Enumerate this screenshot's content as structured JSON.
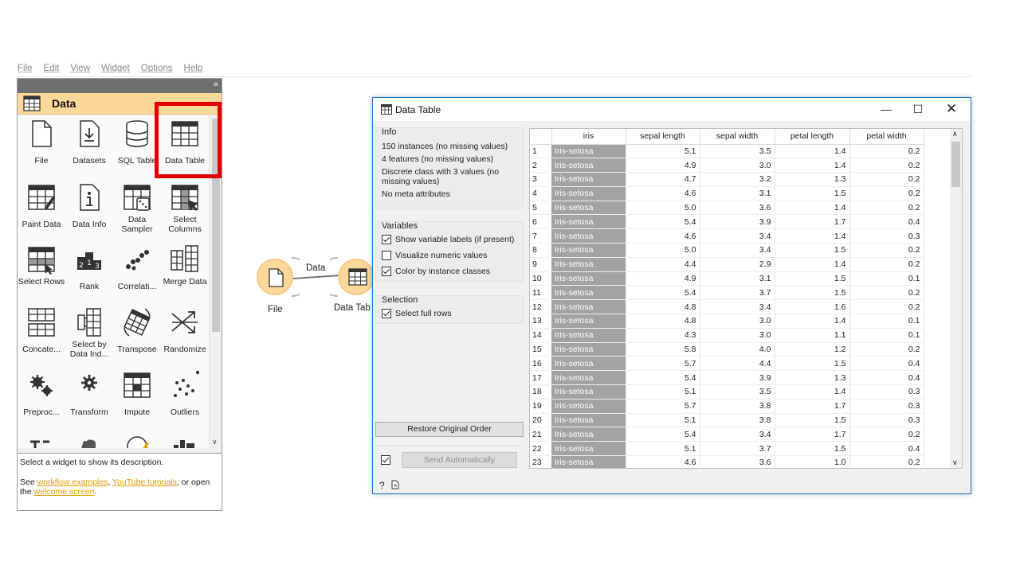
{
  "menu": [
    "File",
    "Edit",
    "View",
    "Widget",
    "Options",
    "Help"
  ],
  "panel": {
    "collapse": "«",
    "category": "Data",
    "widgets": [
      {
        "label": "File",
        "icon": "file-icon"
      },
      {
        "label": "Datasets",
        "icon": "datasets-icon"
      },
      {
        "label": "SQL Table",
        "icon": "sql-table-icon"
      },
      {
        "label": "Data Table",
        "icon": "data-table-icon"
      },
      {
        "label": "Paint Data",
        "icon": "paint-data-icon"
      },
      {
        "label": "Data Info",
        "icon": "data-info-icon"
      },
      {
        "label": "Data Sampler",
        "icon": "data-sampler-icon"
      },
      {
        "label": "Select Columns",
        "icon": "select-columns-icon"
      },
      {
        "label": "Select Rows",
        "icon": "select-rows-icon"
      },
      {
        "label": "Rank",
        "icon": "rank-icon"
      },
      {
        "label": "Correlati...",
        "icon": "correlations-icon"
      },
      {
        "label": "Merge Data",
        "icon": "merge-data-icon"
      },
      {
        "label": "Concate...",
        "icon": "concatenate-icon"
      },
      {
        "label": "Select by Data Ind...",
        "icon": "select-by-index-icon"
      },
      {
        "label": "Transpose",
        "icon": "transpose-icon"
      },
      {
        "label": "Randomize",
        "icon": "randomize-icon"
      },
      {
        "label": "Preproc...",
        "icon": "preprocess-icon"
      },
      {
        "label": "Transform",
        "icon": "transform-icon"
      },
      {
        "label": "Impute",
        "icon": "impute-icon"
      },
      {
        "label": "Outliers",
        "icon": "outliers-icon"
      }
    ],
    "description": {
      "line1": "Select a widget to show its description.",
      "see": "See ",
      "link_workflows": "workflow examples",
      "comma": ", ",
      "link_youtube": "YouTube tutorials",
      "or_open": ", or open",
      "the": "the ",
      "link_welcome": "welcome screen",
      "period": "."
    }
  },
  "canvas": {
    "file_node": "File",
    "table_node": "Data Tab",
    "link": "Data"
  },
  "window": {
    "title": "Data Table",
    "info": {
      "title": "Info",
      "lines": [
        "150 instances (no missing values)",
        "4 features (no missing values)",
        "Discrete class with 3 values (no missing values)",
        "No meta attributes"
      ]
    },
    "variables": {
      "title": "Variables",
      "options": [
        {
          "label": "Show variable labels (if present)",
          "checked": true
        },
        {
          "label": "Visualize numeric values",
          "checked": false
        },
        {
          "label": "Color by instance classes",
          "checked": true
        }
      ]
    },
    "selection": {
      "title": "Selection",
      "option": "Select full rows",
      "checked": true
    },
    "restore_button": "Restore Original Order",
    "send_button": "Send Automatically",
    "send_checked": true,
    "table": {
      "columns": [
        "iris",
        "sepal length",
        "sepal width",
        "petal length",
        "petal width"
      ],
      "rows": [
        [
          "1",
          "Iris-setosa",
          "5.1",
          "3.5",
          "1.4",
          "0.2"
        ],
        [
          "2",
          "Iris-setosa",
          "4.9",
          "3.0",
          "1.4",
          "0.2"
        ],
        [
          "3",
          "Iris-setosa",
          "4.7",
          "3.2",
          "1.3",
          "0.2"
        ],
        [
          "4",
          "Iris-setosa",
          "4.6",
          "3.1",
          "1.5",
          "0.2"
        ],
        [
          "5",
          "Iris-setosa",
          "5.0",
          "3.6",
          "1.4",
          "0.2"
        ],
        [
          "6",
          "Iris-setosa",
          "5.4",
          "3.9",
          "1.7",
          "0.4"
        ],
        [
          "7",
          "Iris-setosa",
          "4.6",
          "3.4",
          "1.4",
          "0.3"
        ],
        [
          "8",
          "Iris-setosa",
          "5.0",
          "3.4",
          "1.5",
          "0.2"
        ],
        [
          "9",
          "Iris-setosa",
          "4.4",
          "2.9",
          "1.4",
          "0.2"
        ],
        [
          "10",
          "Iris-setosa",
          "4.9",
          "3.1",
          "1.5",
          "0.1"
        ],
        [
          "11",
          "Iris-setosa",
          "5.4",
          "3.7",
          "1.5",
          "0.2"
        ],
        [
          "12",
          "Iris-setosa",
          "4.8",
          "3.4",
          "1.6",
          "0.2"
        ],
        [
          "13",
          "Iris-setosa",
          "4.8",
          "3.0",
          "1.4",
          "0.1"
        ],
        [
          "14",
          "Iris-setosa",
          "4.3",
          "3.0",
          "1.1",
          "0.1"
        ],
        [
          "15",
          "Iris-setosa",
          "5.8",
          "4.0",
          "1.2",
          "0.2"
        ],
        [
          "16",
          "Iris-setosa",
          "5.7",
          "4.4",
          "1.5",
          "0.4"
        ],
        [
          "17",
          "Iris-setosa",
          "5.4",
          "3.9",
          "1.3",
          "0.4"
        ],
        [
          "18",
          "Iris-setosa",
          "5.1",
          "3.5",
          "1.4",
          "0.3"
        ],
        [
          "19",
          "Iris-setosa",
          "5.7",
          "3.8",
          "1.7",
          "0.3"
        ],
        [
          "20",
          "Iris-setosa",
          "5.1",
          "3.8",
          "1.5",
          "0.3"
        ],
        [
          "21",
          "Iris-setosa",
          "5.4",
          "3.4",
          "1.7",
          "0.2"
        ],
        [
          "22",
          "Iris-setosa",
          "5.1",
          "3.7",
          "1.5",
          "0.4"
        ],
        [
          "23",
          "Iris-setosa",
          "4.6",
          "3.6",
          "1.0",
          "0.2"
        ]
      ]
    }
  },
  "colors": {
    "accent": "#fbd79a",
    "highlight": "#e30000",
    "link": "#e69b00",
    "class_cell": "#a3a3a3"
  }
}
